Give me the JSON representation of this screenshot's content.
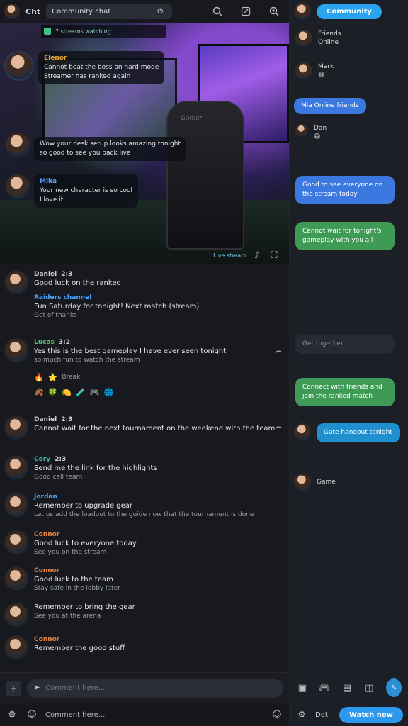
{
  "topbar": {
    "label": "Cht",
    "search_text": "Community chat",
    "icons": [
      "search-icon",
      "edit-icon",
      "zoom-icon"
    ]
  },
  "stream": {
    "bar_text": "7  streams  watching",
    "chair_text": "Gamer",
    "overlay": [
      {
        "name": "Elenor",
        "text": "Cannot beat the boss on hard mode",
        "sub": "Streamer has ranked again"
      },
      {
        "name": "",
        "text": "Wow your desk setup looks amazing tonight",
        "sub": "so good to see you back live"
      },
      {
        "name": "Mika",
        "text": "Your new character is so cool",
        "sub": "I love it"
      }
    ],
    "footer_text": "Live stream"
  },
  "chat": {
    "messages": [
      {
        "name": "Daniel",
        "time": "2:3",
        "text": "Good luck on the ranked",
        "sub": "",
        "extra_name": "Raiders channel",
        "extra_text": "Fun Saturday for tonight! Next match (stream)",
        "extra_sub": "Get of thanks"
      },
      {
        "name": "Lucas",
        "time": "3:2",
        "text": "Yes this is the best gameplay I have ever seen tonight",
        "sub": "so much fun to watch the stream",
        "emoji_label": "Break"
      },
      {
        "name": "Daniel",
        "time": "2:3",
        "text": "Cannot wait for the next tournament on the weekend with the team",
        "sub": ""
      },
      {
        "name": "Cory",
        "time": "2:3",
        "text": "Send me the link for the highlights",
        "sub": "Good call team"
      },
      {
        "name": "Jordan",
        "time": "",
        "text": "Remember to upgrade gear",
        "sub": "Let us add the loadout to the guide now that the tournament is done"
      },
      {
        "name": "Connor",
        "time": "",
        "text": "Good luck to everyone today",
        "sub": "See you on the stream"
      },
      {
        "name": "Connor",
        "time": "",
        "text": "Good luck to the team",
        "sub": "Stay safe in the lobby later"
      },
      {
        "name": "",
        "time": "",
        "text": "Remember to bring the gear",
        "sub": "See you at the arena"
      },
      {
        "name": "Connor",
        "time": "",
        "text": "Remember the good stuff",
        "sub": ""
      }
    ]
  },
  "input": {
    "placeholder": "Comment here..."
  },
  "bottombar": {
    "text": "Comment here..."
  },
  "right": {
    "header_pill": "Community",
    "items": [
      {
        "name": "Friends",
        "sub": "Online",
        "time": ""
      },
      {
        "name": "Mark",
        "sub": "",
        "time": ""
      },
      {
        "pill": "Mia",
        "pill_text": "Online friends",
        "time": ""
      },
      {
        "name": "Dan",
        "sub": "",
        "time": ""
      }
    ],
    "bubbles": [
      {
        "text": "Good to see everyone on the stream today",
        "color": "blue",
        "time": ""
      },
      {
        "text": "Cannot wait for tonight's gameplay with you all",
        "color": "green",
        "time": ""
      },
      {
        "text": "Get together",
        "color": "dark",
        "time": ""
      },
      {
        "text": "Connect with friends and join the ranked match",
        "color": "green",
        "time": ""
      },
      {
        "text": "Gate hangout tonight",
        "color": "cyan",
        "time": ""
      },
      {
        "text": "Game",
        "color": "dark",
        "time": ""
      }
    ],
    "footer_icons": [
      "image-icon",
      "gamepad-icon",
      "gift-icon",
      "sticker-icon"
    ],
    "bottom_label": "Dot",
    "primary_button": "Watch now"
  },
  "colors": {
    "accent": "#2aa3f0",
    "green": "#3e9a55",
    "bg": "#17191e"
  }
}
